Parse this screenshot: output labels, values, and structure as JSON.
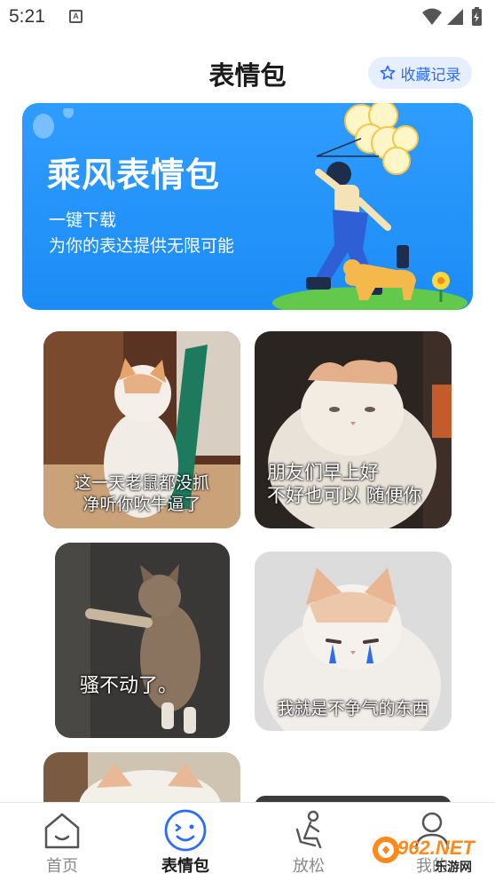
{
  "status_bar": {
    "time": "5:21",
    "notification_icon": "A"
  },
  "header": {
    "title": "表情包",
    "favorites_label": "收藏记录"
  },
  "banner": {
    "title": "乘风表情包",
    "subtitle_line1": "一键下载",
    "subtitle_line2": "为你的表达提供无限可能"
  },
  "stickers": [
    {
      "caption_line1": "这一天老鼠都没抓",
      "caption_line2": "净听你吹牛逼了"
    },
    {
      "caption_line1": "朋友们早上好",
      "caption_line2": "不好也可以 随便你"
    },
    {
      "caption_line1": "骚不动了。",
      "caption_line2": ""
    },
    {
      "caption_line1": "我就是不争气的东西",
      "caption_line2": ""
    }
  ],
  "bottom_nav": {
    "items": [
      {
        "label": "首页",
        "icon": "home-icon"
      },
      {
        "label": "表情包",
        "icon": "smile-icon"
      },
      {
        "label": "放松",
        "icon": "massage-chair-icon"
      },
      {
        "label": "我的",
        "icon": "user-icon"
      }
    ],
    "active": "表情包"
  },
  "watermark": {
    "text": "962.NET",
    "sub": "乐游网"
  },
  "colors": {
    "accent": "#2d6df6",
    "banner": "#1c8cf5",
    "nav_inactive": "#8a8a8a"
  }
}
